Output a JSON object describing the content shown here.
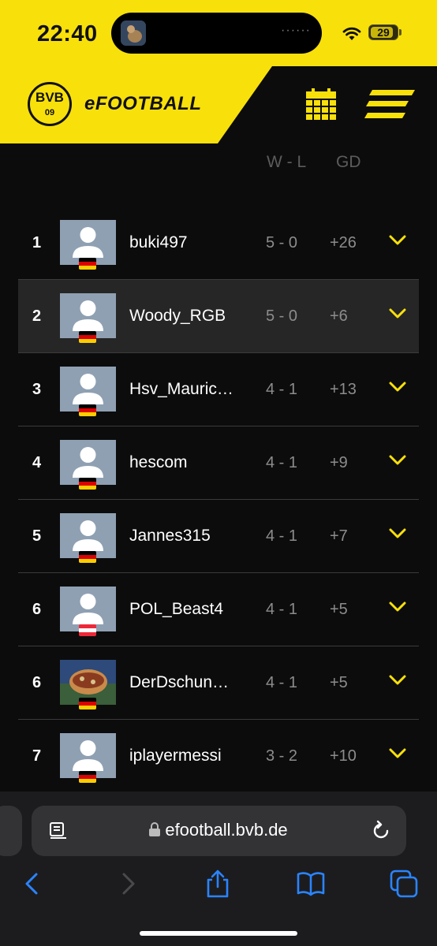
{
  "status_bar": {
    "time": "22:40",
    "battery": "29",
    "island_dots": "······"
  },
  "brand": {
    "logo_text": "BVB",
    "logo_year": "09",
    "app_name": "eFOOTBALL"
  },
  "colors": {
    "accent": "#f8e00b",
    "background": "#0c0c0c",
    "muted": "#8c8c8c"
  },
  "table": {
    "headers": {
      "wl": "W - L",
      "gd": "GD"
    },
    "rows": [
      {
        "rank": "1",
        "name": "buki497",
        "wl": "5 - 0",
        "gd": "+26",
        "flag": "germany",
        "avatar": "default-avatar-icon",
        "highlight": false
      },
      {
        "rank": "2",
        "name": "Woody_RGB",
        "wl": "5 - 0",
        "gd": "+6",
        "flag": "germany",
        "avatar": "default-avatar-icon",
        "highlight": true
      },
      {
        "rank": "3",
        "name": "Hsv_Mauric…",
        "wl": "4 - 1",
        "gd": "+13",
        "flag": "germany",
        "avatar": "default-avatar-icon",
        "highlight": false
      },
      {
        "rank": "4",
        "name": "hescom",
        "wl": "4 - 1",
        "gd": "+9",
        "flag": "germany",
        "avatar": "default-avatar-icon",
        "highlight": false
      },
      {
        "rank": "5",
        "name": "Jannes315",
        "wl": "4 - 1",
        "gd": "+7",
        "flag": "germany",
        "avatar": "default-avatar-icon",
        "highlight": false
      },
      {
        "rank": "6",
        "name": "POL_Beast4",
        "wl": "4 - 1",
        "gd": "+5",
        "flag": "austria",
        "avatar": "default-avatar-icon",
        "highlight": false
      },
      {
        "rank": "6",
        "name": "DerDschun…",
        "wl": "4 - 1",
        "gd": "+5",
        "flag": "germany",
        "avatar": "photo-avatar",
        "highlight": false
      },
      {
        "rank": "7",
        "name": "iplayermessi",
        "wl": "3 - 2",
        "gd": "+10",
        "flag": "germany",
        "avatar": "default-avatar-icon",
        "highlight": false
      }
    ]
  },
  "browser": {
    "url": "efootball.bvb.de"
  }
}
